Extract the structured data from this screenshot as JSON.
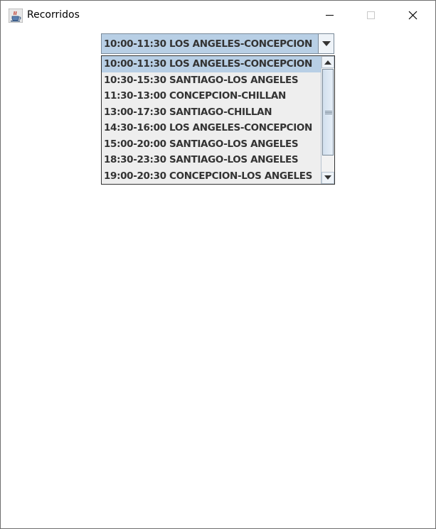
{
  "window": {
    "title": "Recorridos",
    "icon": "java-cup-icon",
    "controls": [
      "minimize-icon",
      "maximize-icon",
      "close-icon"
    ]
  },
  "combo": {
    "selected_value": "10:00-11:30 LOS ANGELES-CONCEPCION",
    "arrow_icon": "chevron-down-icon",
    "selection_color": "#b8cfe5"
  },
  "dropdown": {
    "items": [
      {
        "label": "10:00-11:30 LOS ANGELES-CONCEPCION",
        "selected": true
      },
      {
        "label": "10:30-15:30 SANTIAGO-LOS ANGELES",
        "selected": false
      },
      {
        "label": "11:30-13:00 CONCEPCION-CHILLAN",
        "selected": false
      },
      {
        "label": "13:00-17:30 SANTIAGO-CHILLAN",
        "selected": false
      },
      {
        "label": "14:30-16:00 LOS ANGELES-CONCEPCION",
        "selected": false
      },
      {
        "label": "15:00-20:00 SANTIAGO-LOS ANGELES",
        "selected": false
      },
      {
        "label": "18:30-23:30 SANTIAGO-LOS ANGELES",
        "selected": false
      },
      {
        "label": "19:00-20:30 CONCEPCION-LOS ANGELES",
        "selected": false
      }
    ],
    "scrollbar": {
      "up_icon": "arrow-up-icon",
      "down_icon": "arrow-down-icon",
      "position_fraction": 0,
      "visible_fraction": 0.85
    }
  }
}
